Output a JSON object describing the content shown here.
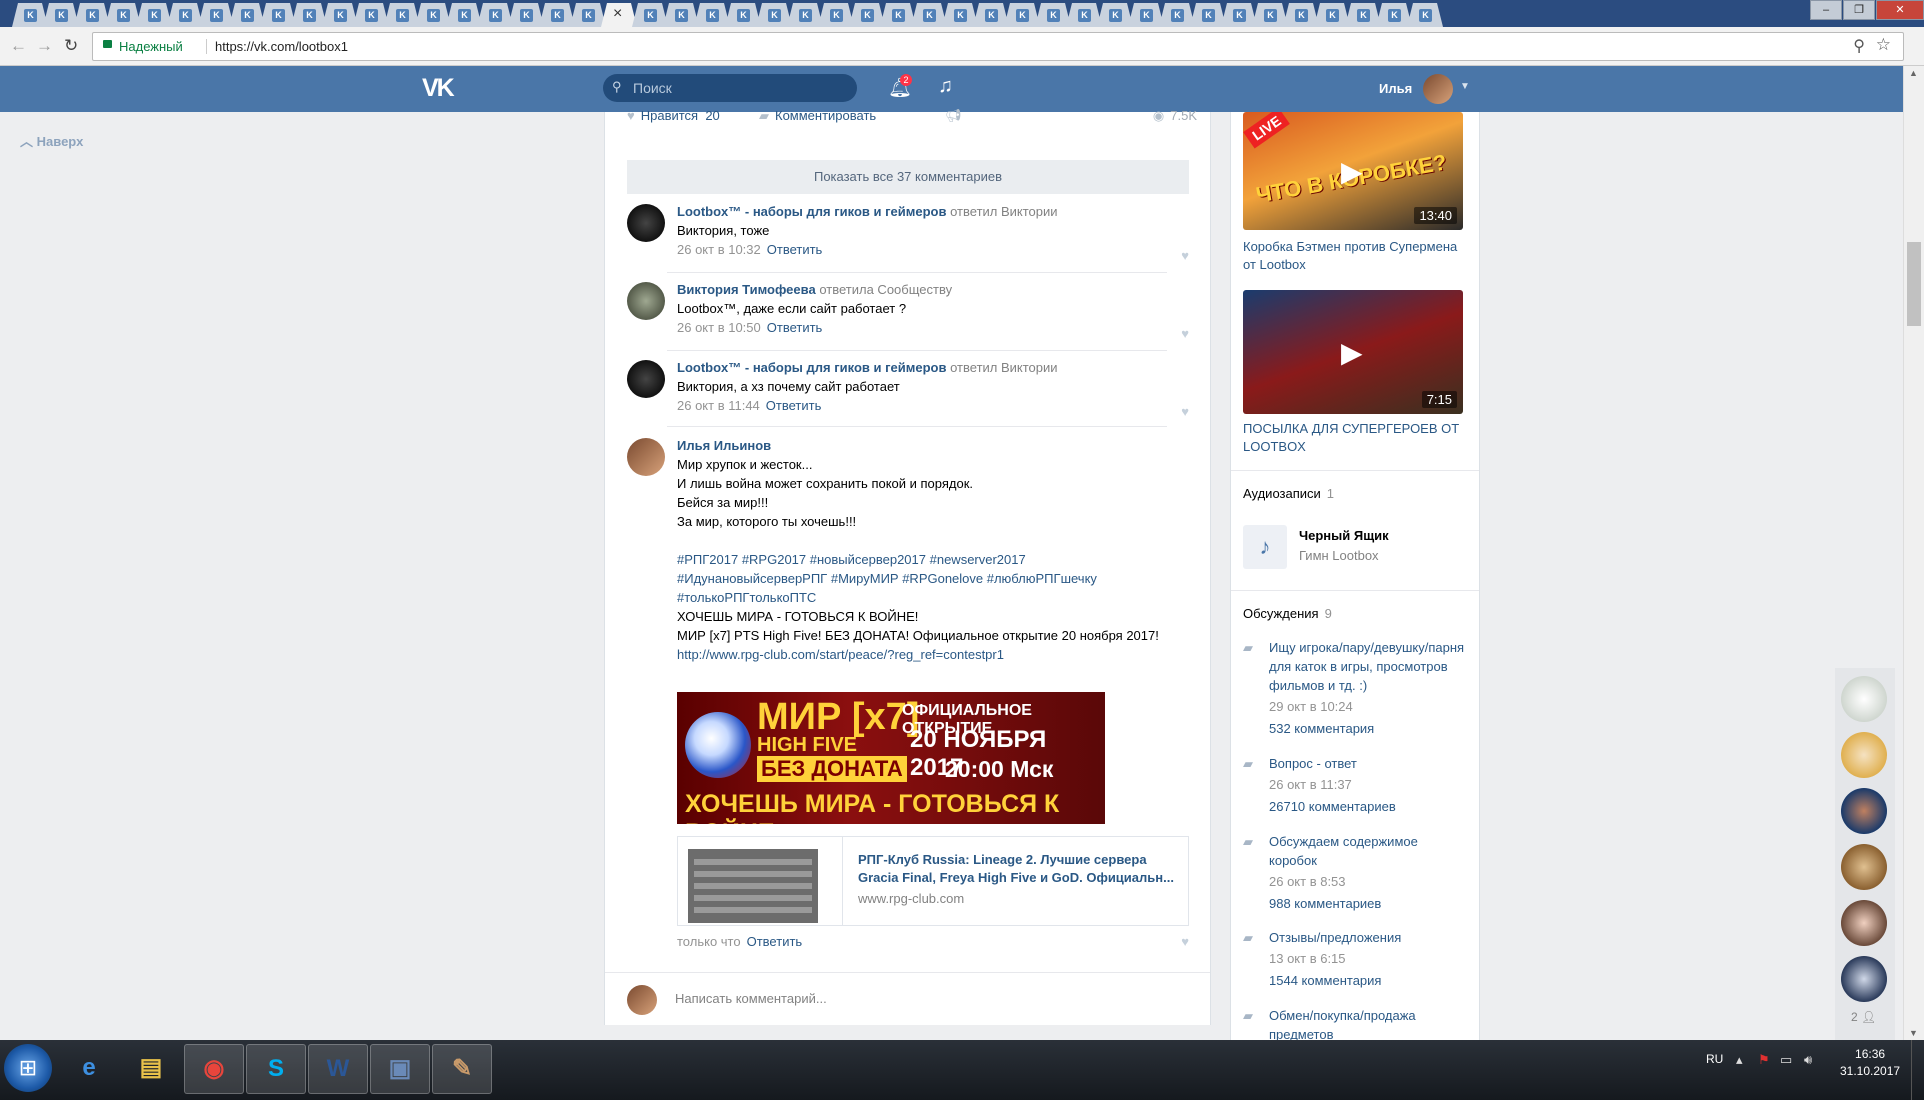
{
  "browser": {
    "active_tab_close": "×",
    "tab_favicon_letter": "K",
    "secure_label": "Надежный",
    "url": "https://vk.com/lootbox1",
    "window_controls": [
      "–",
      "❐",
      "✕"
    ]
  },
  "vk_header": {
    "logo": "VK",
    "search_placeholder": "Поиск",
    "notifications_count": "2",
    "user_name": "Илья"
  },
  "left_nav": {
    "to_top_label": "Наверх"
  },
  "post": {
    "actions": {
      "like_label": "Нравится",
      "like_count": "20",
      "comment_label": "Комментировать",
      "views": "7.5K"
    },
    "show_all_comments": "Показать все 37 комментариев",
    "comments": [
      {
        "author": "Lootbox™ - наборы для гиков и геймеров",
        "reply_to": "ответил Виктории",
        "text": "Виктория, тоже",
        "date": "26 окт в 10:32",
        "reply_label": "Ответить"
      },
      {
        "author": "Виктория Тимофеева",
        "reply_to": "ответила Сообществу",
        "text": "Lootbox™, даже если сайт работает ?",
        "date": "26 окт в 10:50",
        "reply_label": "Ответить"
      },
      {
        "author": "Lootbox™ - наборы для гиков и геймеров",
        "reply_to": "ответил Виктории",
        "text": "Виктория, а хз почему сайт работает",
        "date": "26 окт в 11:44",
        "reply_label": "Ответить"
      }
    ],
    "long_comment": {
      "author": "Илья Ильинов",
      "lines": [
        "Мир хрупок и жесток...",
        "И лишь война может сохранить покой и порядок.",
        "Бейся за мир!!!",
        "За мир, которого ты хочешь!!!"
      ],
      "tags_line1": "#РПГ2017 #RPG2017 #новыйсервер2017 #newserver2017",
      "tags_line2": "#ИдунановыйсерверРПГ #МируМИР #RPGonelove #люблюРПГшечку",
      "tags_line3": "#толькоРПГтолькоПТС",
      "text2": "ХОЧЕШЬ МИРА - ГОТОВЬСЯ К ВОЙНЕ!",
      "text3": "МИР [x7] PTS High Five! БЕЗ ДОНАТА! Официальное открытие 20 ноября 2017!",
      "link": "http://www.rpg-club.com/start/peace/?reg_ref=contestpr1",
      "banner": {
        "title": "МИР [x7]",
        "high_five": "HIGH FIVE",
        "no_donate": "БЕЗ ДОНАТА",
        "official": "ОФИЦИАЛЬНОЕ ОТКРЫТИЕ",
        "date": "20 НОЯБРЯ 2017",
        "time": "20:00 Мск",
        "bottom": "ХОЧЕШЬ МИРА - ГОТОВЬСЯ К ВОЙНЕ"
      },
      "link_card": {
        "title": "РПГ-Клуб Russia: Lineage 2. Лучшие сервера Gracia Final, Freya High Five и GoD. Официальн...",
        "domain": "www.rpg-club.com"
      },
      "date": "только что",
      "reply_label": "Ответить"
    },
    "write_placeholder": "Написать комментарий..."
  },
  "right_column": {
    "videos": [
      {
        "title": "Коробка Бэтмен против Супермена от Lootbox",
        "duration": "13:40",
        "overlay_text": "ЧТО В КОРОБКЕ?",
        "live": "LIVE"
      },
      {
        "title": "ПОСЫЛКА ДЛЯ СУПЕРГЕРОЕВ ОТ LOOTBOX",
        "duration": "7:15"
      }
    ],
    "audio": {
      "header": "Аудиозаписи",
      "count": "1",
      "title": "Черный Ящик",
      "artist": "Гимн Lootbox"
    },
    "discussions": {
      "header": "Обсуждения",
      "count": "9",
      "items": [
        {
          "title": "Ищу игрока/пару/девушку/парня для каток в игры, просмотров фильмов и тд. :)",
          "date": "29 окт в 10:24",
          "comments": "532 комментария"
        },
        {
          "title": "Вопрос - ответ",
          "date": "26 окт в 11:37",
          "comments": "26710 комментариев"
        },
        {
          "title": "Обсуждаем содержимое коробок",
          "date": "26 окт в 8:53",
          "comments": "988 комментариев"
        },
        {
          "title": "Отзывы/предложения",
          "date": "13 окт в 6:15",
          "comments": "1544 комментария"
        },
        {
          "title": "Обмен/покупка/продажа предметов",
          "date": "",
          "comments": ""
        }
      ]
    }
  },
  "chat": {
    "count": "2"
  },
  "taskbar": {
    "lang": "RU",
    "time": "16:36",
    "date": "31.10.2017"
  },
  "colors": {
    "vk_blue": "#4a76a8",
    "link": "#2a5885",
    "banner_red": "#8b0f0f",
    "banner_yellow": "#ffd23a"
  }
}
